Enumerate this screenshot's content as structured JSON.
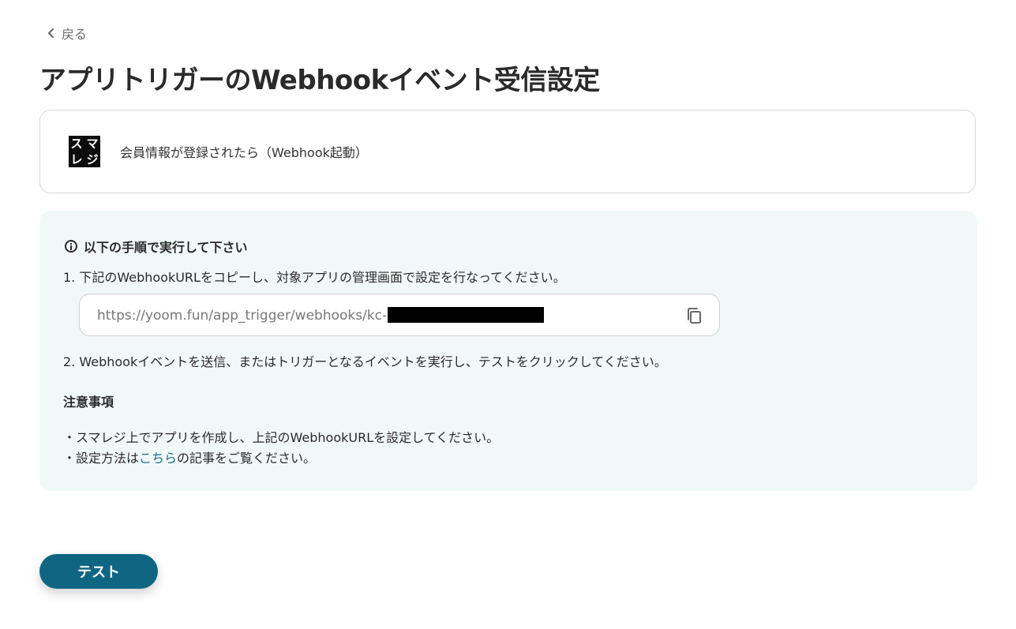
{
  "nav": {
    "back_label": "戻る"
  },
  "page": {
    "title": "アプリトリガーのWebhookイベント受信設定"
  },
  "trigger": {
    "app_logo_text": [
      "ス",
      "マ",
      "レ",
      "ジ"
    ],
    "name": "会員情報が登録されたら（Webhook起動）"
  },
  "instructions": {
    "header": "以下の手順で実行して下さい",
    "step1": "1. 下記のWebhookURLをコピーし、対象アプリの管理画面で設定を行なってください。",
    "webhook_url_visible": "https://yoom.fun/app_trigger/webhooks/kc-",
    "step2": "2. Webhookイベントを送信、またはトリガーとなるイベントを実行し、テストをクリックしてください。"
  },
  "notes": {
    "title": "注意事項",
    "line1": "・スマレジ上でアプリを作成し、上記のWebhookURLを設定してください。",
    "line2_prefix": "・設定方法は",
    "line2_link": "こちら",
    "line2_suffix": "の記事をご覧ください。"
  },
  "actions": {
    "test_label": "テスト"
  },
  "colors": {
    "primary": "#0f6683",
    "panel_bg": "#f1f9f8",
    "link": "#1c6b8a"
  }
}
